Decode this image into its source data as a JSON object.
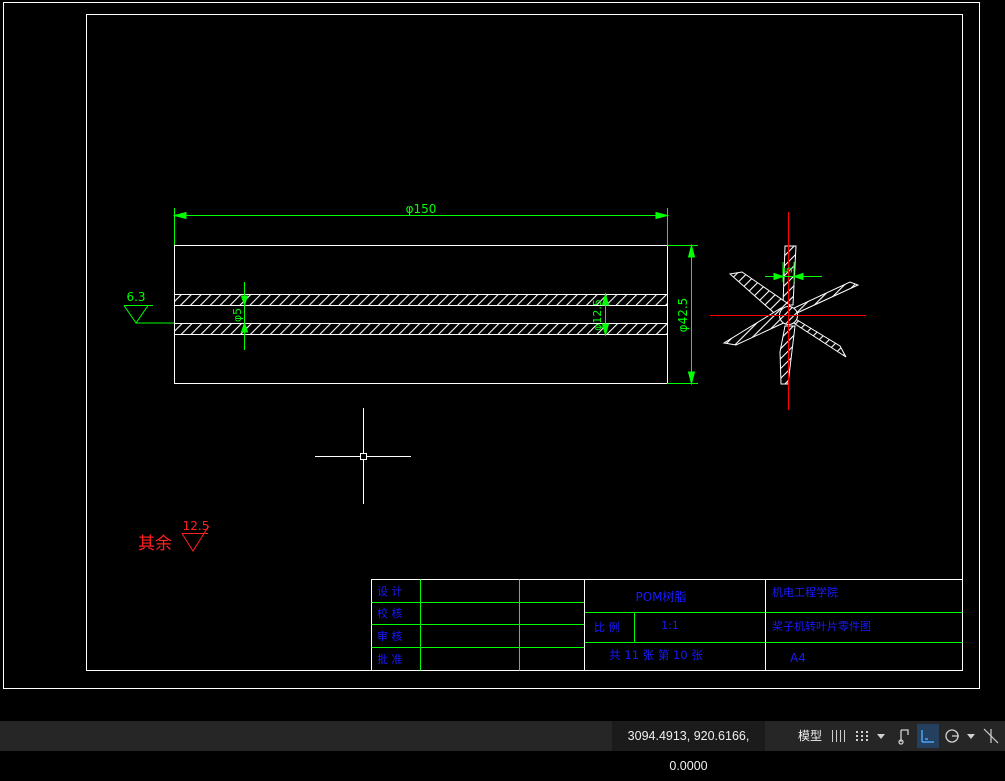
{
  "drawing": {
    "dim_length": "φ150",
    "dim_hole_small": "φ5",
    "dim_hole_mid": "φ12.5",
    "dim_outer": "φ42.5",
    "dim_blade": "5",
    "roughness_main": "6.3",
    "roughness_rest_label": "其余",
    "roughness_rest_value": "12.5"
  },
  "title_block": {
    "designer": "设 计",
    "checker": "校 核",
    "reviewer": "审 核",
    "approver": "批 准",
    "material": "POM树脂",
    "scale_label": "比 例",
    "scale_value": "1:1",
    "sheet_info": "共 11 张 第 10 张",
    "school": "机电工程学院",
    "part_name": "桨子机转叶片零件图",
    "paper_size": "A4"
  },
  "statusbar": {
    "coordinates": "3094.4913, 920.6166, 0.0000",
    "model_tab": "模型"
  },
  "colors": {
    "dimension": "#00ff00",
    "annotation_red": "#ff2020",
    "title_blue": "#1a1aff",
    "geometry": "#ffffff",
    "centerline": "#ff0000"
  }
}
